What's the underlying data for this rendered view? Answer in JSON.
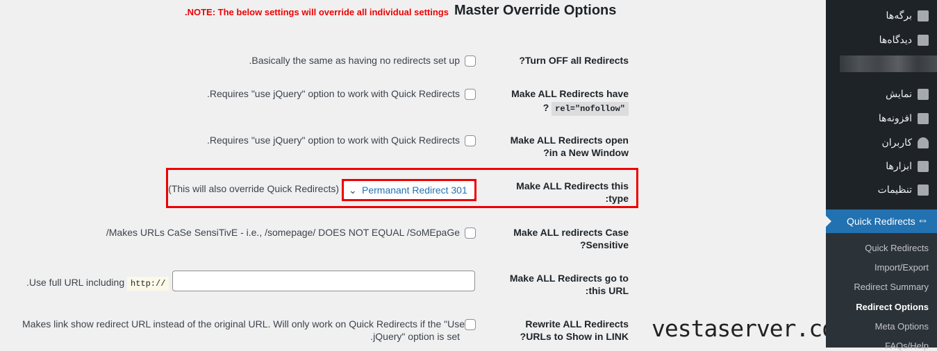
{
  "header": {
    "title": "Master Override Options",
    "note": ".NOTE: The below settings will override all individual settings"
  },
  "rows": [
    {
      "label": "?Turn OFF all Redirects",
      "desc": ".Basically the same as having no redirects set up",
      "checked": false
    },
    {
      "label1": "Make ALL Redirects have",
      "label2": "?",
      "code": "rel=\"nofollow\"",
      "desc": ".Requires \"use jQuery\" option to work with Quick Redirects",
      "checked": false
    },
    {
      "label1": "Make ALL Redirects open",
      "label2": "?in a New Window",
      "desc": ".Requires \"use jQuery\" option to work with Quick Redirects",
      "checked": false
    },
    {
      "label1": "Make ALL Redirects this",
      "label2": ":type",
      "select": "Permanant Redirect 301",
      "desc": "(This will also override Quick Redirects)"
    },
    {
      "label1": "Make ALL redirects Case",
      "label2": "?Sensitive",
      "desc": "/Makes URLs CaSe SensiTivE - i.e., /somepage/ DOES NOT EQUAL /SoMEpaGe",
      "checked": false
    },
    {
      "label1": "Make ALL Redirects go to",
      "label2": ":this URL",
      "input_value": "",
      "desc_prefix": ".Use full URL including",
      "code": "http://"
    },
    {
      "label1": "Rewrite ALL Redirects",
      "label2": "?URLs to Show in LINK",
      "desc1": "Makes link show redirect URL instead of the original URL. Will only work on Quick Redirects if the \"Use",
      "desc2": ".jQuery\" option is set",
      "checked": false
    }
  ],
  "sidebar": {
    "items": [
      {
        "label": "برگه‌ها",
        "icon": "pages-icon"
      },
      {
        "label": "دیدگاه‌ها",
        "icon": "comments-icon"
      },
      {
        "label": "نمایش",
        "icon": "appearance-icon"
      },
      {
        "label": "افزونه‌ها",
        "icon": "plugins-icon"
      },
      {
        "label": "کاربران",
        "icon": "users-icon"
      },
      {
        "label": "ابزارها",
        "icon": "tools-icon"
      },
      {
        "label": "تنظیمات",
        "icon": "settings-icon"
      }
    ],
    "active": {
      "label": "Quick Redirects",
      "icon": "redirect-arrows-icon"
    },
    "sub": [
      "Quick Redirects",
      "Import/Export",
      "Redirect Summary",
      "Redirect Options",
      "Meta Options",
      "FAQs/Help"
    ],
    "sub_current": "Redirect Options"
  },
  "watermark": "vestaserver.com",
  "colors": {
    "accent": "#2271b1",
    "note": "#ee0000",
    "sidebar": "#1d2327"
  }
}
